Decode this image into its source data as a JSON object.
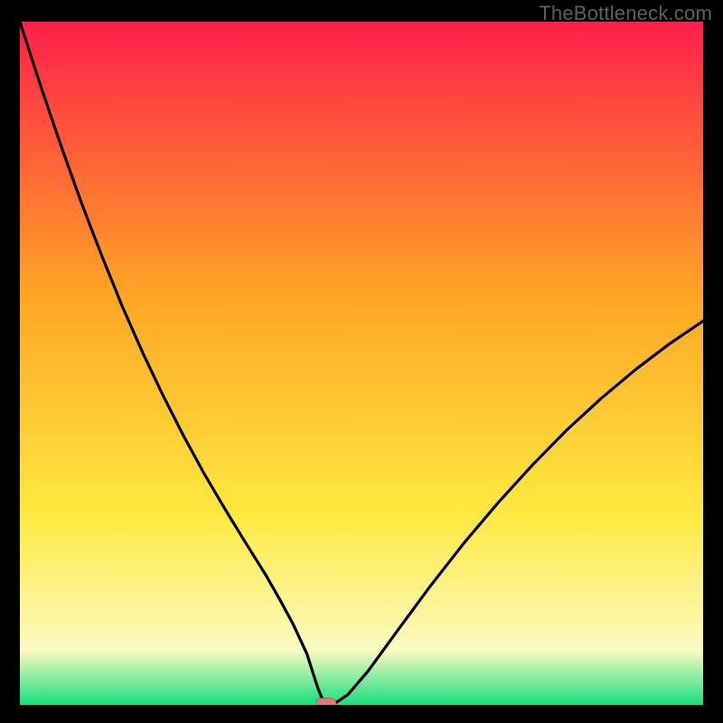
{
  "watermark": "TheBottleneck.com",
  "colors": {
    "frame": "#000000",
    "gradient_top": "#ff1f4a",
    "gradient_mid": "#ffa524",
    "gradient_low": "#ffe940",
    "gradient_pale": "#fbfac2",
    "gradient_bottom": "#15e07e",
    "line": "#000000",
    "marker_fill": "#e07a7a",
    "marker_stroke": "#b85e5e",
    "watermark_text": "#5e5e5e"
  },
  "chart_data": {
    "type": "line",
    "title": "",
    "xlabel": "",
    "ylabel": "",
    "xlim": [
      0,
      100
    ],
    "ylim": [
      0,
      100
    ],
    "grid": false,
    "annotations": [
      "TheBottleneck.com"
    ],
    "series": [
      {
        "name": "bottleneck-curve",
        "x": [
          0,
          3,
          6,
          9,
          12,
          15,
          18,
          21,
          24,
          27,
          30,
          33,
          36,
          38,
          40,
          42,
          42.8,
          43.6,
          44.2,
          45,
          46.2,
          48,
          51,
          55,
          60,
          65,
          70,
          75,
          80,
          85,
          90,
          95,
          100
        ],
        "y": [
          100,
          90.7,
          81.9,
          73.5,
          65.7,
          58.3,
          51.5,
          45.2,
          39.3,
          33.8,
          28.7,
          23.8,
          19.0,
          15.5,
          11.8,
          7.5,
          5.0,
          2.5,
          1.0,
          0.4,
          0.3,
          1.5,
          5.0,
          10.5,
          17.3,
          23.7,
          29.6,
          35.1,
          40.2,
          44.8,
          49.0,
          52.8,
          56.2
        ]
      }
    ],
    "marker": {
      "x": 44.8,
      "y": 0.25,
      "name": "optimal-point"
    }
  }
}
